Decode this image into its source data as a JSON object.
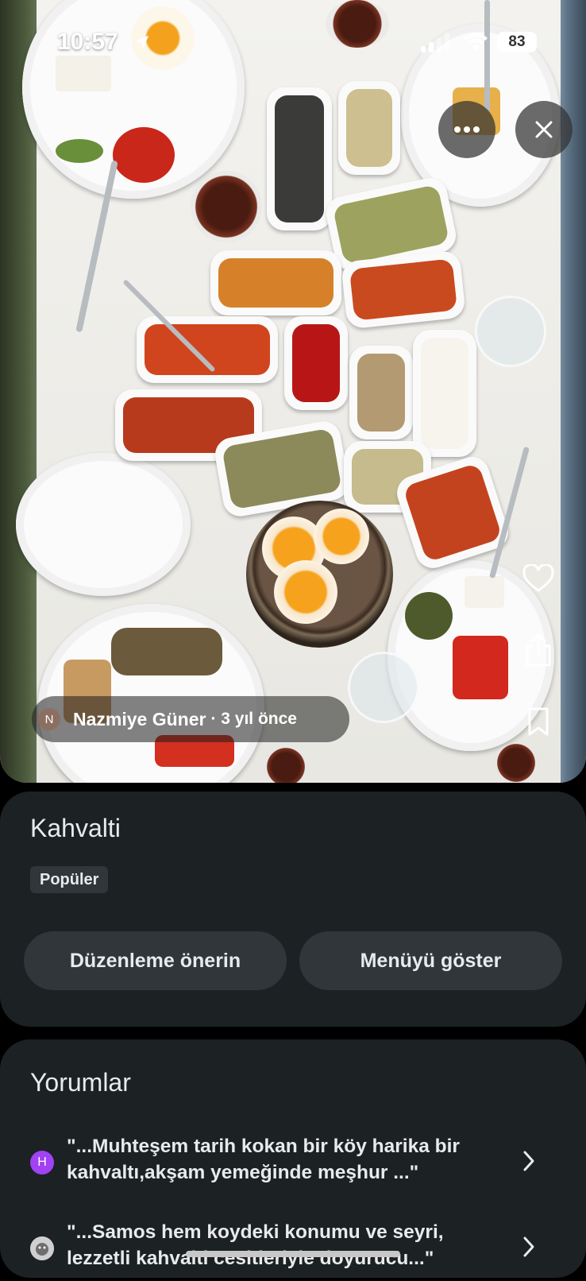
{
  "status_bar": {
    "time": "10:57",
    "battery": "83"
  },
  "photo": {
    "author_initial": "N",
    "author_name": "Nazmiye Güner",
    "posted_ago": "· 3 yıl önce"
  },
  "actions": {
    "more_icon": "more-horizontal-icon",
    "close_icon": "close-icon",
    "like_icon": "heart-icon",
    "share_icon": "share-icon",
    "save_icon": "bookmark-icon"
  },
  "dish": {
    "title": "Kahvalti",
    "badge": "Popüler",
    "suggest_edit_label": "Düzenleme önerin",
    "show_menu_label": "Menüyü göster"
  },
  "reviews": {
    "title": "Yorumlar",
    "items": [
      {
        "avatar": "H",
        "avatar_color": "#a142f4",
        "text": "\"...Muhteşem tarih kokan bir köy harika bir kahvaltı,akşam yemeğinde meşhur ...\""
      },
      {
        "avatar": "",
        "avatar_color": "#9aa0a6",
        "text": "\"...Samos hem koydeki konumu ve seyri, lezzetli kahvalti cesitleriyle doyurucu...\""
      }
    ]
  }
}
